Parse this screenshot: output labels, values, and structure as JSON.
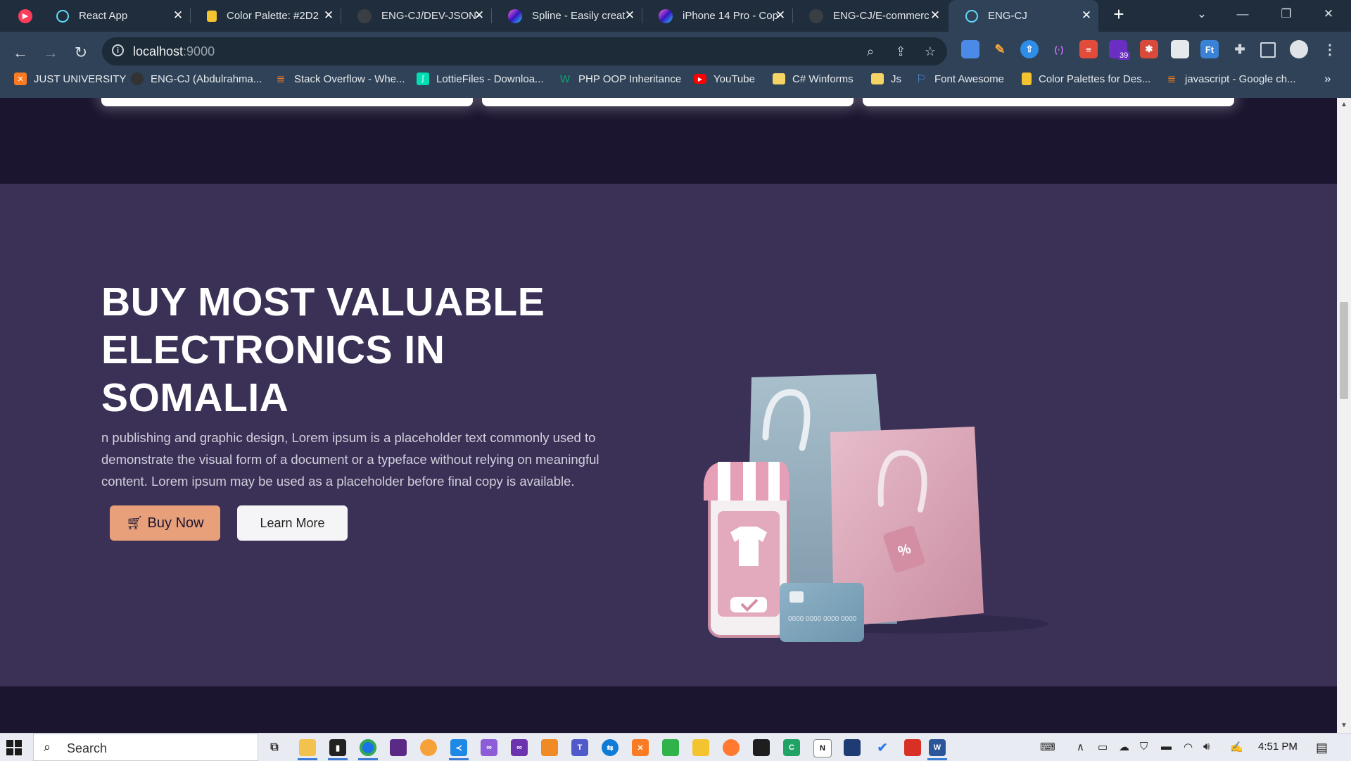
{
  "browser": {
    "tabs": [
      {
        "title": "",
        "icon": "youtube-music-icon",
        "color": "#ff3d5a"
      },
      {
        "title": "React App",
        "icon": "react-icon",
        "color": "#61dafb"
      },
      {
        "title": "Color Palette: #2D2",
        "icon": "color-palette-icon",
        "color": "#f4c430"
      },
      {
        "title": "ENG-CJ/DEV-JSON-",
        "icon": "github-icon",
        "color": "#444444"
      },
      {
        "title": "Spline - Easily creat",
        "icon": "spline-icon",
        "color": "#7b61ff"
      },
      {
        "title": "iPhone 14 Pro - Cop",
        "icon": "figma-icon",
        "color": "#a259ff"
      },
      {
        "title": "ENG-CJ/E-commerc",
        "icon": "github-icon",
        "color": "#444444"
      },
      {
        "title": "ENG-CJ",
        "icon": "react-icon",
        "color": "#61dafb"
      }
    ],
    "new_tab": "+",
    "address": {
      "host": "localhost",
      "port": ":9000"
    },
    "extensions": {
      "badge_count": "39"
    },
    "bookmarks": [
      {
        "label": "JUST UNIVERSITY",
        "icon": "xampp-icon",
        "color": "#fb7a24"
      },
      {
        "label": "ENG-CJ (Abdulrahma...",
        "icon": "github-icon",
        "color": "#333333"
      },
      {
        "label": "Stack Overflow - Whe...",
        "icon": "stackoverflow-icon",
        "color": "#f48024"
      },
      {
        "label": "LottieFiles - Downloa...",
        "icon": "lottiefiles-icon",
        "color": "#00ddb3"
      },
      {
        "label": "PHP OOP Inheritance",
        "icon": "w3schools-icon",
        "color": "#04aa6d"
      },
      {
        "label": "YouTube",
        "icon": "youtube-icon",
        "color": "#ff0000"
      },
      {
        "label": "C# Winforms",
        "icon": "folder-icon",
        "color": "#f6d365"
      },
      {
        "label": "Js",
        "icon": "folder-icon",
        "color": "#f6d365"
      },
      {
        "label": "Font Awesome",
        "icon": "flag-icon",
        "color": "#538dd7"
      },
      {
        "label": "Color Palettes for Des...",
        "icon": "color-palette-icon",
        "color": "#f4c430"
      },
      {
        "label": "javascript - Google ch...",
        "icon": "stackoverflow-icon",
        "color": "#f48024"
      }
    ],
    "more_bookmarks": "»"
  },
  "page": {
    "hero": {
      "title": "BUY MOST VALUABLE ELECTRONICS IN SOMALIA",
      "text": "n publishing and graphic design, Lorem ipsum is a placeholder text commonly used to demonstrate the visual form of a document or a typeface without relying on meaningful content. Lorem ipsum may be used as a placeholder before final copy is available.",
      "buy_label": "Buy Now",
      "learn_label": "Learn More",
      "card_number": "0000 0000 0000 0000",
      "tag_symbol": "%"
    },
    "colors": {
      "hero_bg": "#3b3156",
      "page_bg": "#1b1530",
      "buy_button": "#e7a07a",
      "learn_button": "#f5f5f7"
    }
  },
  "taskbar": {
    "search_placeholder": "Search",
    "time": "4:51 PM"
  }
}
